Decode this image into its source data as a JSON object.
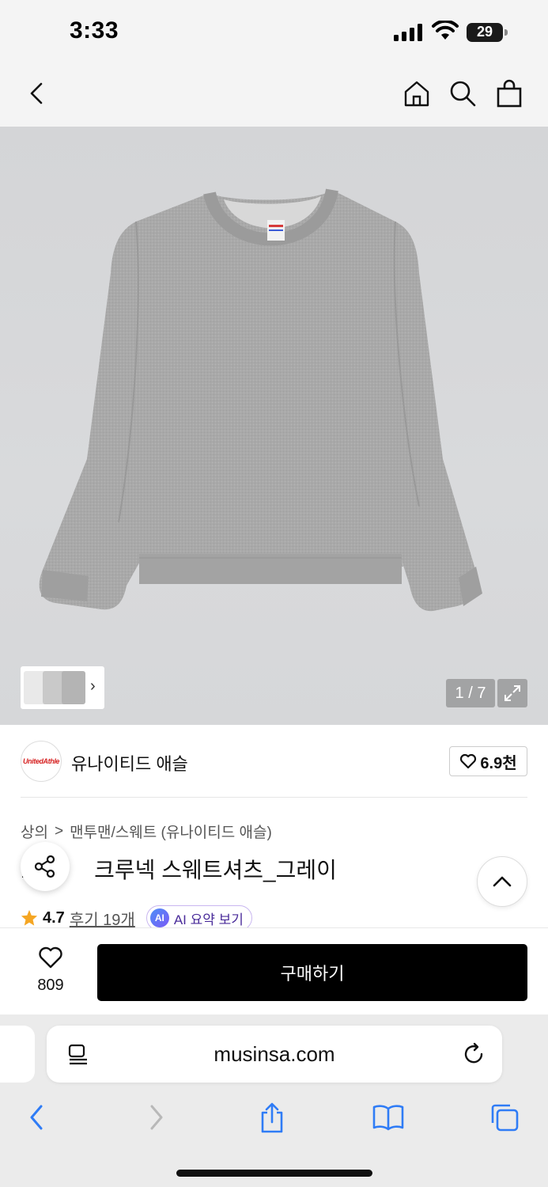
{
  "status_bar": {
    "time": "3:33",
    "battery": "29"
  },
  "nav": {
    "back_icon": "chevron-left-icon",
    "home_icon": "home-icon",
    "search_icon": "search-icon",
    "cart_icon": "shopping-bag-icon"
  },
  "gallery": {
    "pager": "1 / 7",
    "image_index": 1,
    "image_total": 7
  },
  "brand": {
    "logo_text": "UnitedAthle",
    "name": "유나이티드 애슬",
    "likes": "6.9천"
  },
  "breadcrumb": {
    "category": "상의",
    "separator": ">",
    "subcategory": "맨투맨/스웨트 (유나이티드 애슬)"
  },
  "product": {
    "title_prefix": "1",
    "title": "크루넥 스웨트셔츠_그레이"
  },
  "rating": {
    "value": "4.7",
    "reviews": "후기 19개",
    "ai_badge": "AI",
    "ai_summary": "AI 요약 보기"
  },
  "purchase": {
    "wish_count": "809",
    "buy_label": "구매하기"
  },
  "browser": {
    "url": "musinsa.com"
  },
  "colors": {
    "accent_black": "#000000",
    "star": "#f5a623",
    "ai_purple": "#4a2c9a",
    "ios_blue": "#2f7cf6"
  }
}
